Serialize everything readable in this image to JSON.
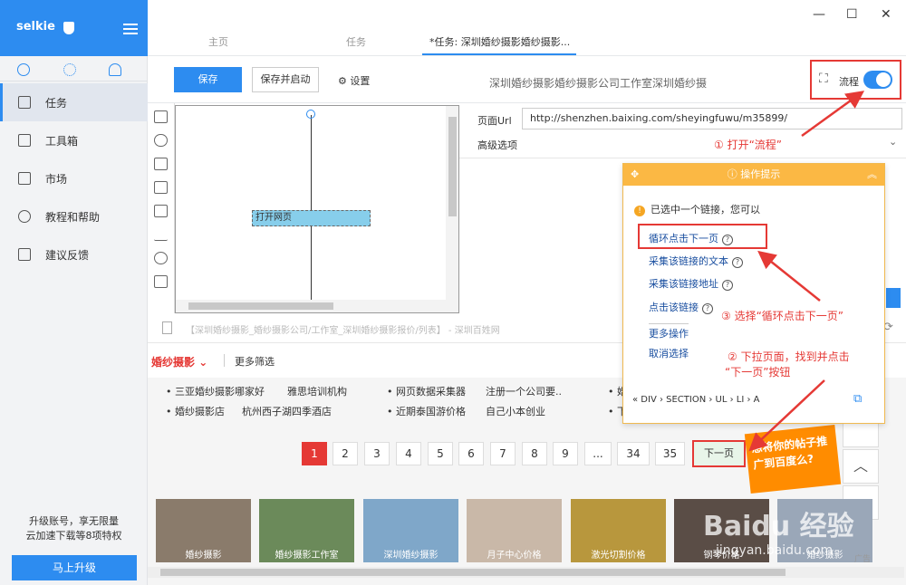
{
  "sidebar": {
    "brand": "selkie",
    "items": [
      {
        "label": "任务"
      },
      {
        "label": "工具箱"
      },
      {
        "label": "市场"
      },
      {
        "label": "教程和帮助"
      },
      {
        "label": "建议反馈"
      }
    ],
    "upgrade_text_1": "升级账号，享无限量",
    "upgrade_text_2": "云加速下载等8项特权",
    "upgrade_button": "马上升级"
  },
  "tabs": [
    {
      "label": "主页"
    },
    {
      "label": "任务"
    },
    {
      "label": "*任务: 深圳婚纱摄影婚纱摄影..."
    }
  ],
  "window": {
    "minimize": "—",
    "maximize": "☐",
    "close": "✕"
  },
  "toolbar": {
    "save": "保存",
    "save_run": "保存并启动",
    "settings": "设置",
    "page_heading": "深圳婚纱摄影婚纱摄影公司工作室深圳婚纱摄",
    "flow_label": "流程",
    "flow_on": true
  },
  "flow": {
    "node_label": "打开网页"
  },
  "url_panel": {
    "url_label": "页面Url",
    "url_value": "http://shenzhen.baixing.com/sheyingfuwu/m35899/",
    "advanced": "高级选项"
  },
  "browser": {
    "address": "【深圳婚纱摄影_婚纱摄影公司/工作室_深圳婚纱摄影报价/列表】 - 深圳百姓网",
    "category": "婚纱摄影",
    "more_filter": "更多筛选",
    "links_row1": [
      "三亚婚纱摄影哪家好",
      "雅思培训机构",
      "网页数据采集器",
      "注册一个公司要..",
      "婚"
    ],
    "links_row2": [
      "婚纱摄影店",
      "杭州西子湖四季酒店",
      "近期泰国游价格",
      "自己小本创业",
      "下"
    ],
    "pages": [
      "1",
      "2",
      "3",
      "4",
      "5",
      "6",
      "7",
      "8",
      "9",
      "...",
      "34",
      "35"
    ],
    "current_page": "1",
    "next": "下一页",
    "thumbs": [
      "婚纱摄影",
      "婚纱摄影工作室",
      "深圳婚纱摄影",
      "月子中心价格",
      "激光切割价格",
      "钢琴价格",
      "婚纱摄影"
    ],
    "ad_text": "想将你的帖子推广到百度么?",
    "ad_label": "广告"
  },
  "tip": {
    "title": "操作提示",
    "message": "已选中一个链接，您可以",
    "options": [
      "循环点击下一页",
      "采集该链接的文本",
      "采集该链接地址",
      "点击该链接",
      "更多操作",
      "取消选择"
    ],
    "breadcrumb": "«  DIV  ›  SECTION  ›  UL  ›  LI  ›  A"
  },
  "annotations": {
    "step1": "① 打开“流程”",
    "step2a": "② 下拉页面，找到并点击",
    "step2b": "“下一页”按钮",
    "step3": "③ 选择“循环点击下一页”"
  },
  "watermark": "Baidu 经验",
  "watermark_url": "jingyan.baidu.com",
  "colors": {
    "accent": "#2d8cf0",
    "annotation": "#e53935",
    "tip_header": "#fbb844"
  }
}
